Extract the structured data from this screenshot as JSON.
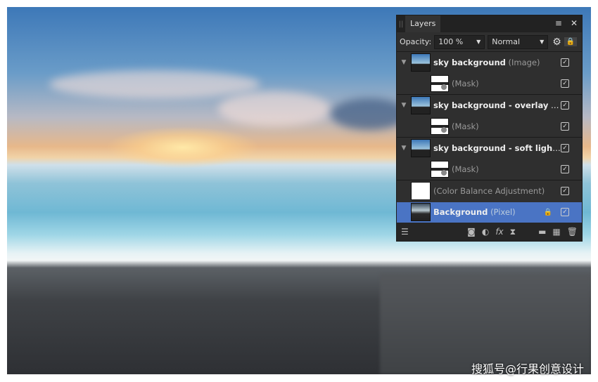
{
  "panel": {
    "tab": "Layers",
    "opacity_label": "Opacity:",
    "opacity_value": "100 %",
    "blend_mode": "Normal",
    "layers": [
      {
        "name": "sky background",
        "type": "(Image)",
        "expanded": true,
        "visible": true
      },
      {
        "name": "",
        "type": "(Mask)",
        "visible": true
      },
      {
        "name": "sky background - overlay",
        "type": "(I...",
        "expanded": true,
        "visible": true
      },
      {
        "name": "",
        "type": "(Mask)",
        "visible": true
      },
      {
        "name": "sky background - soft light...",
        "type": "",
        "expanded": true,
        "visible": true
      },
      {
        "name": "",
        "type": "(Mask)",
        "visible": true
      },
      {
        "name": "",
        "type": "(Color Balance Adjustment)",
        "visible": true
      },
      {
        "name": "Background",
        "type": "(Pixel)",
        "visible": true,
        "locked": true,
        "selected": true
      }
    ]
  },
  "watermark": "搜狐号@行果创意设计",
  "colors": {
    "selected_row": "#4a74c4",
    "panel_bg": "#2f2f2f"
  }
}
